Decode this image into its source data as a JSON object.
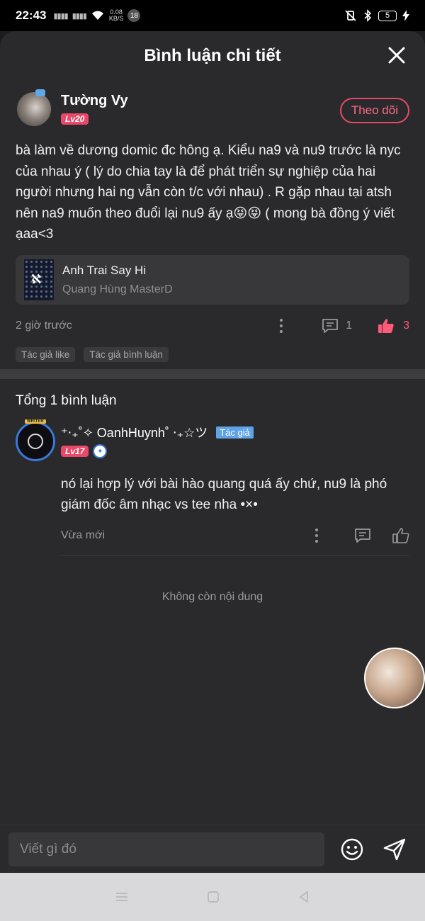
{
  "status_bar": {
    "time": "22:43",
    "net_speed_value": "0.08",
    "net_speed_unit": "KB/S",
    "notif_count": "18",
    "battery": "5"
  },
  "header": {
    "title": "Bình luận chi tiết"
  },
  "post": {
    "author_name": "Tường Vy",
    "level": "Lv20",
    "follow_label": "Theo dõi",
    "text": "bà làm về dương domic đc hông ạ. Kiểu na9 và nu9 trước là nyc của nhau ý ( lý do chia tay là để phát triển sự nghiệp của hai người nhưng hai ng vẫn còn t/c với nhau) . R gặp nhau tại atsh nên na9 muốn theo đuổi lại nu9 ấy ạ😝😝 ( mong bà đồng ý viết ạaa<3",
    "song": {
      "title": "Anh Trai Say Hi",
      "artist": "Quang Hùng MasterD"
    },
    "time": "2 giờ trước",
    "comment_count": "1",
    "like_count": "3",
    "tags": [
      "Tác giả like",
      "Tác giả bình luận"
    ]
  },
  "comments_section": {
    "total_label": "Tổng 1 bình luận",
    "items": [
      {
        "name": "⁺‧₊˚✧ OanhHuynh˚ ‧₊☆ツ",
        "author_tag": "Tác giả",
        "level": "Lv17",
        "text": "nó lại hợp lý với bài hào quang quá ấy chứ, nu9 là phó giám đốc âm nhạc vs tee nha •×•",
        "time": "Vừa mới"
      }
    ],
    "end_label": "Không còn nội dung"
  },
  "input_bar": {
    "placeholder": "Viết gì đó"
  },
  "colors": {
    "accent": "#e8496a",
    "like": "#ff5a78",
    "author_tag": "#5fa3e6",
    "sheet_bg": "#2a2a2c"
  }
}
